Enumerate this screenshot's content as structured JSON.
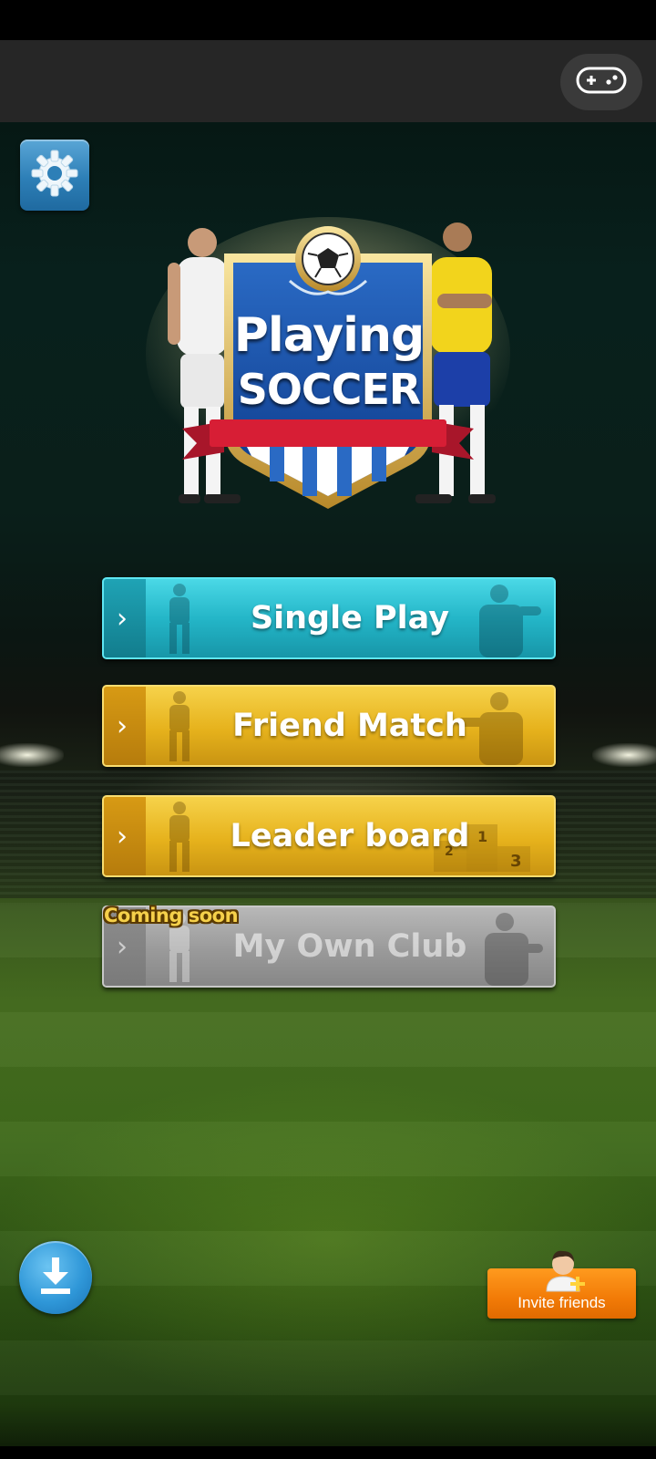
{
  "topbar": {
    "game_controller_icon": "gamepad-icon"
  },
  "settings": {
    "icon": "gear-icon"
  },
  "logo": {
    "line1": "Playing",
    "line2": "SOCCER"
  },
  "menu": {
    "items": [
      {
        "label": "Single Play",
        "color": "#24b6c8"
      },
      {
        "label": "Friend Match",
        "color": "#e6b21c"
      },
      {
        "label": "Leader board",
        "color": "#e6b21c",
        "podium": [
          "1",
          "2",
          "3"
        ]
      },
      {
        "label": "My Own Club",
        "color": "#9a9a9a",
        "badge": "Coming soon"
      }
    ]
  },
  "download": {
    "icon": "download-icon"
  },
  "invite": {
    "label": "Invite friends",
    "icon": "add-friend-icon",
    "color": "#f27b07"
  }
}
